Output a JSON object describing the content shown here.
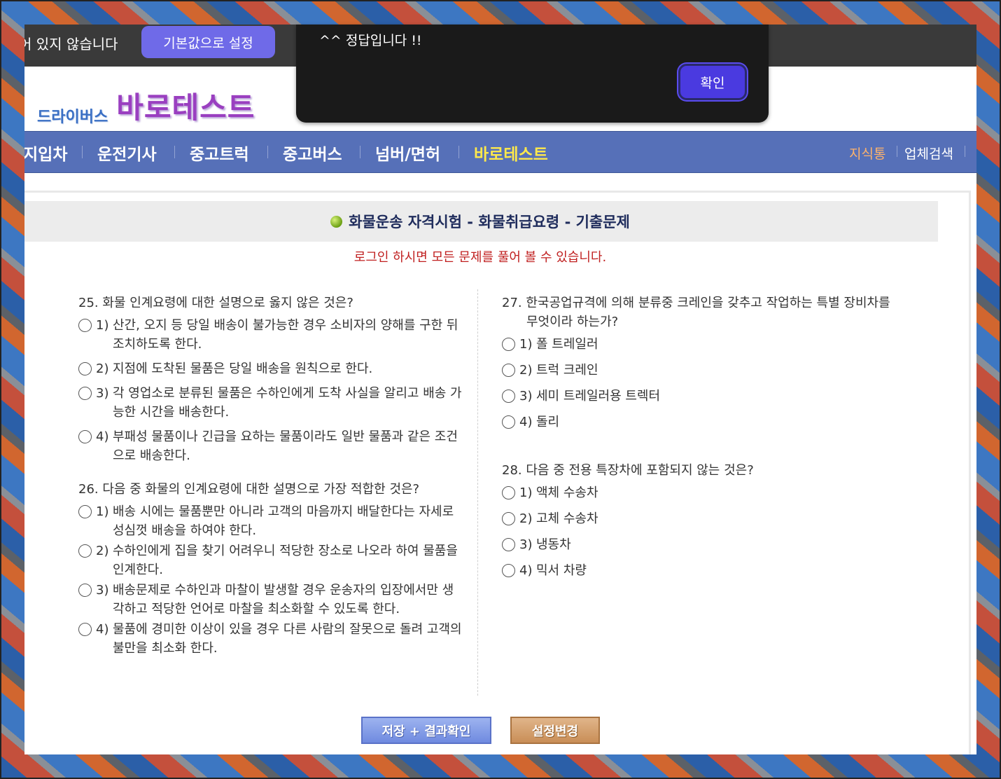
{
  "topbar": {
    "notice_text": "어 있지 않습니다",
    "default_button": "기본값으로 설정"
  },
  "toast": {
    "message": "^^ 정답입니다 !!",
    "confirm_button": "확인"
  },
  "logo": {
    "small": "드라이버스",
    "big": "바로테스트"
  },
  "nav": {
    "items": [
      "지입차",
      "운전기사",
      "중고트럭",
      "중고버스",
      "넘버/면허",
      "바로테스트"
    ],
    "right_items": [
      "지식통",
      "업체검색"
    ]
  },
  "title": "화물운송 자격시험 - 화물취급요령 - 기출문제",
  "login_message": "로그인 하시면 모든 문제를 풀어 볼 수 있습니다.",
  "questions": [
    {
      "title": "25. 화물 인계요령에 대한 설명으로 옳지 않은 것은?",
      "options": [
        {
          "num": "1)",
          "text": "산간, 오지 등 당일 배송이 불가능한 경우 소비자의 양해를 구한 뒤 조치하도록 한다."
        },
        {
          "num": "2)",
          "text": "지점에 도착된 물품은 당일 배송을 원칙으로 한다."
        },
        {
          "num": "3)",
          "text": "각 영업소로 분류된 물품은 수하인에게 도착 사실을 알리고 배송 가능한 시간을 배송한다."
        },
        {
          "num": "4)",
          "text": "부패성 물품이나 긴급을 요하는 물품이라도 일반 물품과 같은 조건으로 배송한다."
        }
      ]
    },
    {
      "title": "26. 다음 중 화물의 인계요령에 대한 설명으로 가장 적합한 것은?",
      "options": [
        {
          "num": "1)",
          "text": "배송 시에는 물품뿐만 아니라 고객의 마음까지 배달한다는 자세로 성심껏 배송을 하여야 한다."
        },
        {
          "num": "2)",
          "text": "수하인에게 집을 찾기 어려우니 적당한 장소로 나오라 하여 물품을 인계한다."
        },
        {
          "num": "3)",
          "text": "배송문제로 수하인과 마찰이 발생할 경우 운송자의 입장에서만 생각하고 적당한 언어로 마찰을 최소화할 수 있도록 한다."
        },
        {
          "num": "4)",
          "text": "물품에 경미한 이상이 있을 경우 다른 사람의 잘못으로 돌려 고객의 불만을 최소화 한다."
        }
      ]
    },
    {
      "title": "27. 한국공업규격에 의해 분류중 크레인을 갖추고 작업하는 특별 장비차를 무엇이라 하는가?",
      "options": [
        {
          "num": "1)",
          "text": "폴 트레일러"
        },
        {
          "num": "2)",
          "text": "트럭 크레인"
        },
        {
          "num": "3)",
          "text": "세미 트레일러용 트렉터"
        },
        {
          "num": "4)",
          "text": "돌리"
        }
      ]
    },
    {
      "title": "28. 다음 중 전용 특장차에 포함되지 않는 것은?",
      "options": [
        {
          "num": "1)",
          "text": "액체 수송차"
        },
        {
          "num": "2)",
          "text": "고체 수송차"
        },
        {
          "num": "3)",
          "text": "냉동차"
        },
        {
          "num": "4)",
          "text": "믹서 차량"
        }
      ]
    }
  ],
  "buttons": {
    "save": "저장 + 결과확인",
    "settings": "설정변경"
  }
}
